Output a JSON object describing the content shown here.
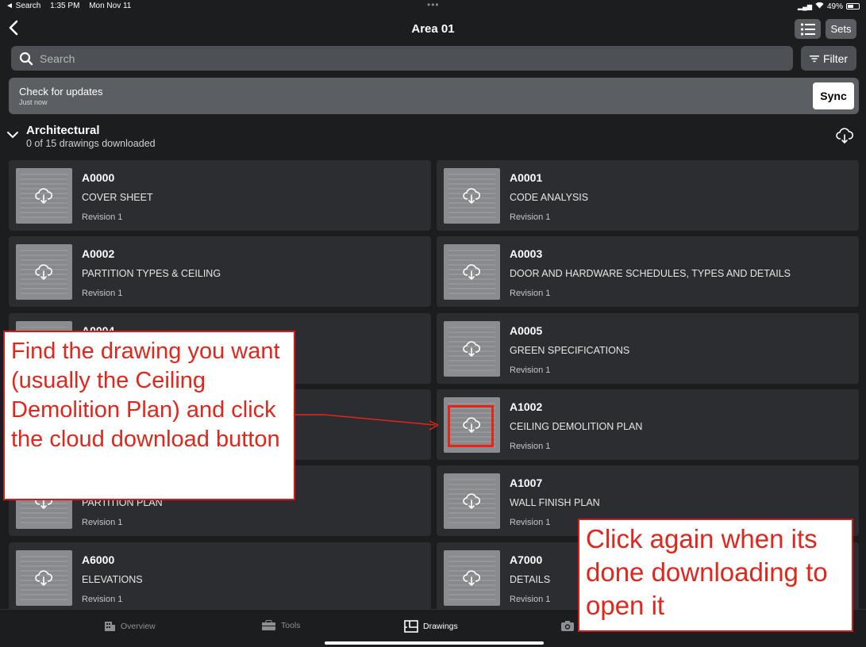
{
  "status": {
    "back_app": "◄ Search",
    "time": "1:35 PM",
    "date": "Mon Nov 11",
    "battery": "49%"
  },
  "nav": {
    "title": "Area 01",
    "sets_label": "Sets"
  },
  "search": {
    "placeholder": "Search",
    "filter_label": "Filter"
  },
  "update": {
    "title": "Check for updates",
    "subtitle": "Just now",
    "sync_label": "Sync"
  },
  "section": {
    "title": "Architectural",
    "subtitle": "0 of 15 drawings downloaded"
  },
  "drawings": [
    {
      "code": "A0000",
      "name": "COVER SHEET",
      "revision": "Revision 1"
    },
    {
      "code": "A0001",
      "name": "CODE ANALYSIS",
      "revision": "Revision 1"
    },
    {
      "code": "A0002",
      "name": "PARTITION TYPES & CEILING",
      "revision": "Revision 1"
    },
    {
      "code": "A0003",
      "name": "DOOR AND HARDWARE SCHEDULES, TYPES AND DETAILS",
      "revision": "Revision 1"
    },
    {
      "code": "A0004",
      "name": "",
      "revision": ""
    },
    {
      "code": "A0005",
      "name": "GREEN SPECIFICATIONS",
      "revision": "Revision 1"
    },
    {
      "code": "",
      "name": "",
      "revision": ""
    },
    {
      "code": "A1002",
      "name": "CEILING DEMOLITION PLAN",
      "revision": "Revision 1"
    },
    {
      "code": "",
      "name": "PARTITION PLAN",
      "revision": "Revision 1"
    },
    {
      "code": "A1007",
      "name": "WALL FINISH PLAN",
      "revision": "Revision 1"
    },
    {
      "code": "A6000",
      "name": "ELEVATIONS",
      "revision": "Revision 1"
    },
    {
      "code": "A7000",
      "name": "DETAILS",
      "revision": "Revision 1"
    }
  ],
  "tabs": {
    "overview": "Overview",
    "tools": "Tools",
    "drawings": "Drawings"
  },
  "callouts": {
    "find": "Find the drawing you want (usually the Ceiling Demolition Plan) and click the cloud download button",
    "again": "Click again when its done downloading to open it"
  },
  "colors": {
    "accent_red": "#e1261c",
    "card": "#2b2d30",
    "background": "#1c1d1f"
  }
}
